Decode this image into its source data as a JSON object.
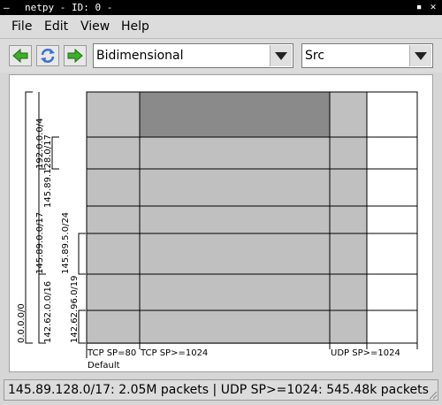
{
  "window": {
    "title": "netpy - ID: 0 -",
    "menu_dash": "—",
    "minimize_glyph": "▪",
    "close_glyph": "✕"
  },
  "menubar": {
    "items": [
      {
        "label": "File"
      },
      {
        "label": "Edit"
      },
      {
        "label": "View"
      },
      {
        "label": "Help"
      }
    ]
  },
  "toolbar": {
    "mode_value": "Bidimensional",
    "field_value": "Src"
  },
  "colors": {
    "dark_cell": "#8a8a8a",
    "light_cell": "#c0c0c0",
    "grid_line": "#000000",
    "arrow_green": "#3fae2a",
    "refresh_blue": "#3b6fd4"
  },
  "tree": {
    "root": "0.0.0.0/0",
    "level1": [
      "192.0.0.0/4",
      "145.89.0.0/17",
      "142.62.0.0/16"
    ],
    "level2": [
      "145.89.128.0/17",
      "145.89.5.0/24",
      "142.62.96.0/19"
    ]
  },
  "columns": {
    "labels": [
      "TCP SP=80",
      "TCP SP>=1024",
      "UDP SP>=1024"
    ],
    "default_label": "Default"
  },
  "status": {
    "text": "145.89.128.0/17: 2.05M packets | UDP SP>=1024: 545.48k packets"
  }
}
